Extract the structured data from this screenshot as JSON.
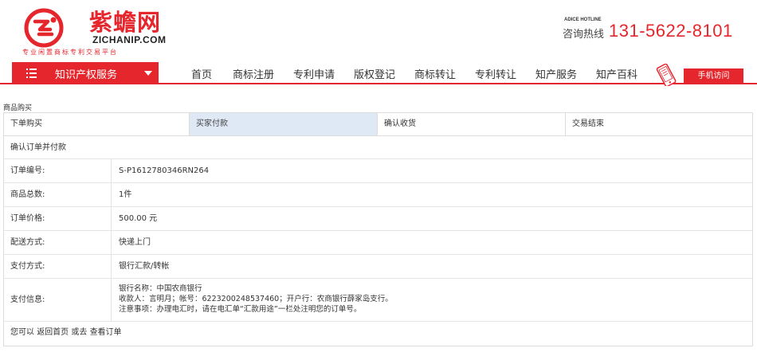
{
  "header": {
    "logo_cn": "紫蟾网",
    "logo_en": "ZICHANIP.COM",
    "logo_tagline": "专业闲置商标专利交易平台",
    "hotline_en": "ADICE HOTLINE",
    "hotline_label": "咨询热线",
    "hotline_number": "131-5622-8101"
  },
  "nav": {
    "menu_label": "知识产权服务",
    "links": [
      "首页",
      "商标注册",
      "专利申请",
      "版权登记",
      "商标转让",
      "专利转让",
      "知产服务",
      "知产百科"
    ],
    "mobile_label": "手机访问"
  },
  "section_title": "商品购买",
  "steps": [
    "下单购买",
    "买家付款",
    "确认收货",
    "交易结束"
  ],
  "confirm_title": "确认订单并付款",
  "order": {
    "id_label": "订单编号:",
    "id_value": "S-P1612780346RN264",
    "total_label": "商品总数:",
    "total_value": "1件",
    "price_label": "订单价格:",
    "price_value": "500.00 元",
    "delivery_label": "配送方式:",
    "delivery_value": "快递上门",
    "payment_label": "支付方式:",
    "payment_value": "银行汇款/转帐",
    "payinfo_label": "支付信息:",
    "payinfo_bank": "银行名称：中国农商银行",
    "payinfo_account": "收款人：言明月；帐号：6223200248537460；开户行：农商银行薛家岛支行。",
    "payinfo_note": "注意事项：办理电汇时，请在电汇单“汇款用途”一栏处注明您的订单号。"
  },
  "footer": {
    "prefix": "您可以",
    "home_link": "返回首页",
    "or": "或去",
    "orders_link": "查看订单"
  },
  "colors": {
    "brand_red": "#e5262c",
    "active_step_bg": "#dfe9f6"
  }
}
